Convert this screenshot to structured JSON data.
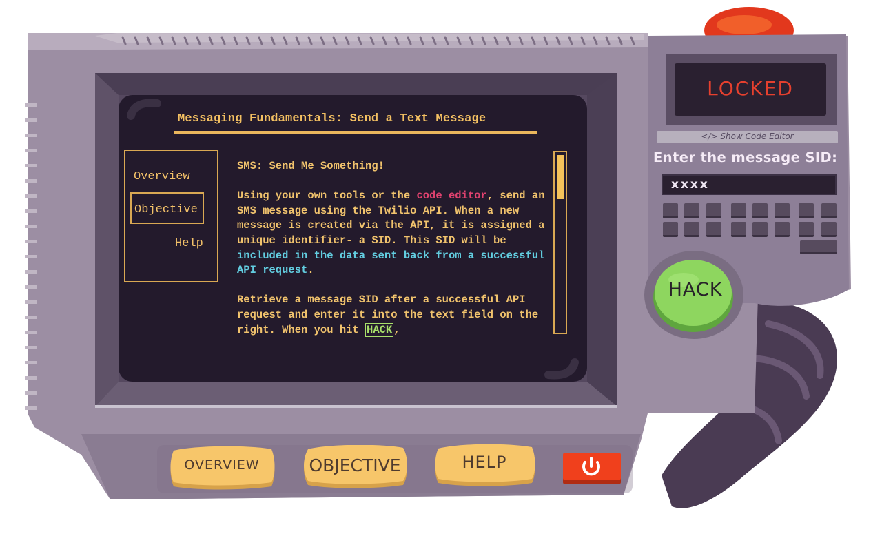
{
  "screen": {
    "title": "Messaging Fundamentals: Send a Text Message",
    "nav": {
      "overview": "Overview",
      "objective": "Objective",
      "help": "Help"
    },
    "content": {
      "heading": "SMS: Send Me Something!",
      "p1_a": "Using your own tools or the ",
      "p1_link": "code editor",
      "p1_b": ", send an SMS message using the Twilio API. When a new message is created via the API, it is assigned a unique identifier- a SID. This SID will be ",
      "p1_highlight": "included in the data sent back from a successful API request",
      "p1_c": ".",
      "p2_a": "Retrieve a message SID after a successful API request and enter it into the text field on the right. When you hit ",
      "p2_tag": "HACK",
      "p2_b": ","
    },
    "scroll_position": 0.0
  },
  "panel": {
    "status": "LOCKED",
    "code_editor_label": "</> Show Code Editor",
    "sid_label": "Enter the message SID:",
    "sid_value": "xxxx",
    "hack_label": "HACK"
  },
  "bottom": {
    "overview": "OVERVIEW",
    "objective": "OBJECTIVE",
    "help": "HELP"
  },
  "colors": {
    "device": "#9c8ea3",
    "screen": "#231a2c",
    "text": "#f1c36d",
    "link": "#e0426f",
    "highlight": "#62cde0",
    "hack_green": "#8ed65f",
    "status_red": "#e6402e",
    "bottom_button": "#f7c66a",
    "power_red": "#f0401c"
  },
  "icons": {
    "power": "power-icon"
  }
}
